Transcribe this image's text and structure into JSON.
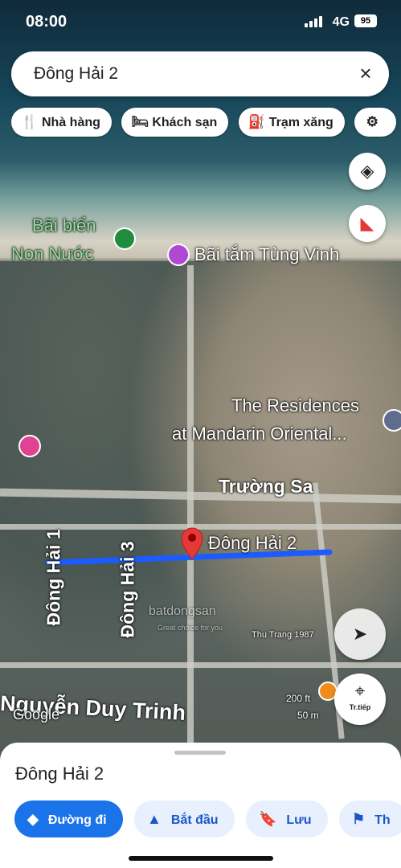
{
  "status_bar": {
    "time": "08:00",
    "network": "4G",
    "battery": "95"
  },
  "search": {
    "query": "Đông Hải 2",
    "clear_icon": "close-icon"
  },
  "chips": [
    {
      "label": "Nhà hàng",
      "icon": "restaurant-icon"
    },
    {
      "label": "Khách sạn",
      "icon": "hotel-icon"
    },
    {
      "label": "Trạm xăng",
      "icon": "gas-station-icon"
    }
  ],
  "map": {
    "labels": {
      "beach1_line1": "Bãi biển",
      "beach1_line2": "Non Nước",
      "beach2": "Bãi tắm Tùng Vinh",
      "residences_line1": "The Residences",
      "residences_line2": "at Mandarin Oriental...",
      "truong_sa": "Trường Sa",
      "dong_hai_2": "Đông Hải 2",
      "dong_hai_1": "Đông Hải 1",
      "dong_hai_3": "Đông Hải 3",
      "nguyen_duy_trinh": "Nguyễn Duy Trinh",
      "thu_trang": "Thu Trang 1987",
      "google": "Google",
      "scale_ft": "200 ft",
      "scale_m": "50 m",
      "watermark": "batdongsan",
      "watermark_sub": "Great choice for you"
    },
    "directions_label": "Tr.tiếp",
    "route_color": "#1a5cff",
    "pin_color": "#e53935"
  },
  "sheet": {
    "title": "Đông Hải 2",
    "actions": [
      {
        "label": "Đường đi",
        "icon": "directions-icon"
      },
      {
        "label": "Bắt đầu",
        "icon": "navigation-icon"
      },
      {
        "label": "Lưu",
        "icon": "bookmark-icon"
      },
      {
        "label": "Th",
        "icon": "flag-icon"
      }
    ]
  }
}
